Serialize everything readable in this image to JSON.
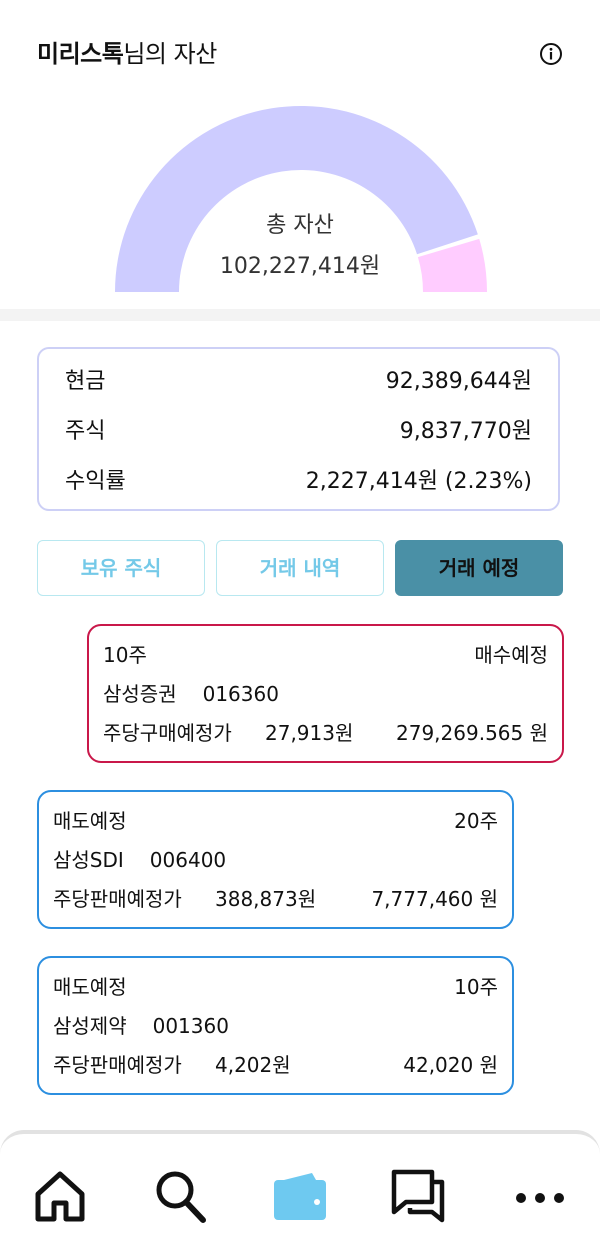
{
  "header": {
    "user_name": "미리스톡",
    "title_suffix": "님의 자산",
    "info_icon": "info-icon"
  },
  "gauge": {
    "label": "총 자산",
    "value": "102,227,414원",
    "cash_share": 0.9038,
    "stock_share": 0.0962,
    "colors": {
      "cash": "#cdccff",
      "stock": "#ffccff"
    }
  },
  "summary": {
    "cash_label": "현금",
    "cash_value": "92,389,644원",
    "stock_label": "주식",
    "stock_value": "9,837,770원",
    "return_label": "수익률",
    "return_value": "2,227,414원 (2.23%)"
  },
  "tabs": [
    {
      "label": "보유 주식",
      "active": false
    },
    {
      "label": "거래 내역",
      "active": false
    },
    {
      "label": "거래 예정",
      "active": true
    }
  ],
  "orders": [
    {
      "type": "매수예정",
      "qty": "10주",
      "name": "삼성증권",
      "code": "016360",
      "price_label": "주당구매예정가",
      "price": "27,913원",
      "total": "279,269.565 원",
      "color": "#c9184a"
    },
    {
      "type": "매도예정",
      "qty": "20주",
      "name": "삼성SDI",
      "code": "006400",
      "price_label": "주당판매예정가",
      "price": "388,873원",
      "total": "7,777,460 원",
      "color": "#2c8fe0"
    },
    {
      "type": "매도예정",
      "qty": "10주",
      "name": "삼성제약",
      "code": "001360",
      "price_label": "주당판매예정가",
      "price": "4,202원",
      "total": "42,020 원",
      "color": "#2c8fe0"
    }
  ],
  "nav": {
    "items": [
      "home-icon",
      "search-icon",
      "wallet-icon",
      "chat-icon",
      "more-icon"
    ],
    "active_color": "#6ec9f0"
  }
}
